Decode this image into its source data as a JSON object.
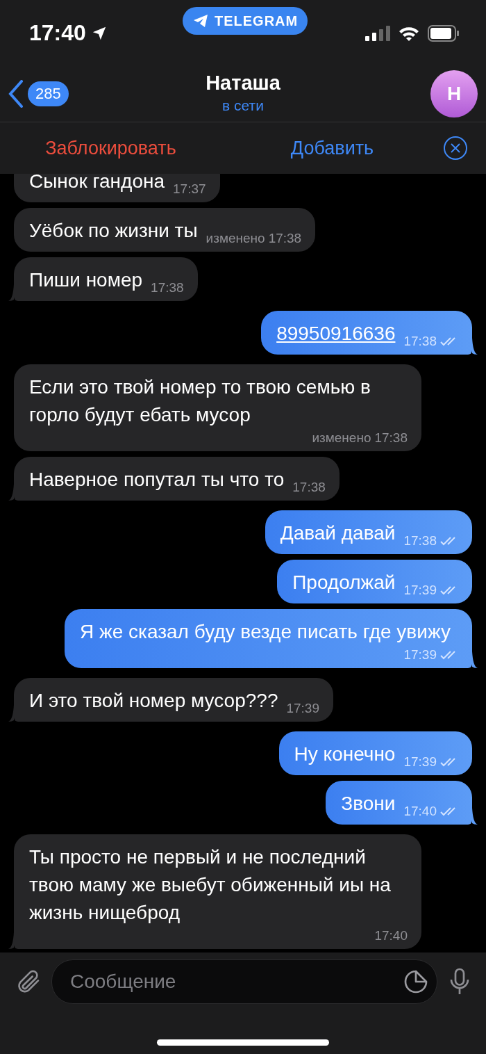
{
  "status_bar": {
    "time": "17:40",
    "app_pill": "TELEGRAM"
  },
  "header": {
    "back_count": "285",
    "name": "Наташа",
    "status": "в сети",
    "avatar_letter": "Н"
  },
  "action_bar": {
    "block": "Заблокировать",
    "add": "Добавить"
  },
  "messages": [
    {
      "kind": "text",
      "outgoing": false,
      "tail": false,
      "text": "Сынок гандона",
      "time": "17:37",
      "read": false
    },
    {
      "kind": "text",
      "outgoing": false,
      "tail": false,
      "text": "Уёбок по жизни ты",
      "edited": "изменено",
      "time": "17:38",
      "read": false
    },
    {
      "kind": "text",
      "outgoing": false,
      "tail": true,
      "text": "Пиши номер",
      "time": "17:38",
      "read": false
    },
    {
      "kind": "link",
      "outgoing": true,
      "tail": true,
      "text": "89950916636",
      "time": "17:38",
      "read": true
    },
    {
      "kind": "text",
      "outgoing": false,
      "tail": false,
      "text": "Если это твой номер то твою семью в горло будут ебать мусор",
      "edited": "изменено",
      "time": "17:38",
      "read": false
    },
    {
      "kind": "text",
      "outgoing": false,
      "tail": true,
      "text": "Наверное попутал ты что то",
      "time": "17:38",
      "read": false
    },
    {
      "kind": "text",
      "outgoing": true,
      "tail": false,
      "text": "Давай давай",
      "time": "17:38",
      "read": true
    },
    {
      "kind": "text",
      "outgoing": true,
      "tail": false,
      "text": "Продолжай",
      "time": "17:39",
      "read": true
    },
    {
      "kind": "text",
      "outgoing": true,
      "tail": true,
      "text": "Я же сказал буду везде писать где увижу",
      "time": "17:39",
      "read": true
    },
    {
      "kind": "text",
      "outgoing": false,
      "tail": true,
      "text": "И это твой номер мусор???",
      "time": "17:39",
      "read": false
    },
    {
      "kind": "text",
      "outgoing": true,
      "tail": false,
      "text": "Ну конечно",
      "time": "17:39",
      "read": true
    },
    {
      "kind": "text",
      "outgoing": true,
      "tail": true,
      "text": "Звони",
      "time": "17:40",
      "read": true
    },
    {
      "kind": "text",
      "outgoing": false,
      "tail": true,
      "text": "Ты просто не первый и не последний твою маму же выебут обиженный иы на жизнь нищеброд",
      "time": "17:40",
      "read": false
    }
  ],
  "composer": {
    "placeholder": "Сообщение"
  }
}
